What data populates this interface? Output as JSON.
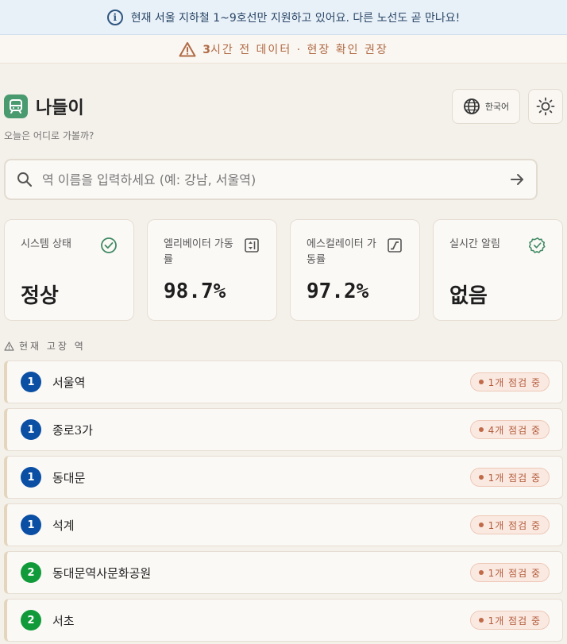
{
  "info_banner": {
    "text": "현재 서울 지하철 1~9호선만 지원하고 있어요. 다른 노선도 곧 만나요!",
    "icon": "info-icon"
  },
  "warn_banner": {
    "highlight": "3",
    "text": "시간 전 데이터 · 현장 확인 권장",
    "icon": "warning-icon"
  },
  "header": {
    "title": "나들이",
    "tagline": "오늘은 어디로 가볼까?",
    "language_label": "한국어"
  },
  "search": {
    "placeholder": "역 이름을 입력하세요 (예: 강남, 서울역)",
    "value": ""
  },
  "stats": [
    {
      "label": "시스템 상태",
      "value": "정상",
      "icon": "check-circle-icon"
    },
    {
      "label": "엘리베이터 가동률",
      "value": "98.7%",
      "icon": "elevator-icon"
    },
    {
      "label": "에스컬레이터 가동률",
      "value": "97.2%",
      "icon": "escalator-icon"
    },
    {
      "label": "실시간 알림",
      "value": "없음",
      "icon": "verified-badge-icon"
    }
  ],
  "section_title": "현재 고장 역",
  "stations": [
    {
      "line": "1",
      "line_color": "#0a4fa3",
      "name": "서울역",
      "status": "1개 점검 중"
    },
    {
      "line": "1",
      "line_color": "#0a4fa3",
      "name": "종로3가",
      "status": "4개 점검 중"
    },
    {
      "line": "1",
      "line_color": "#0a4fa3",
      "name": "동대문",
      "status": "1개 점검 중"
    },
    {
      "line": "1",
      "line_color": "#0a4fa3",
      "name": "석계",
      "status": "1개 점검 중"
    },
    {
      "line": "2",
      "line_color": "#119a3a",
      "name": "동대문역사문화공원",
      "status": "1개 점검 중"
    },
    {
      "line": "2",
      "line_color": "#119a3a",
      "name": "서초",
      "status": "1개 점검 중"
    }
  ]
}
